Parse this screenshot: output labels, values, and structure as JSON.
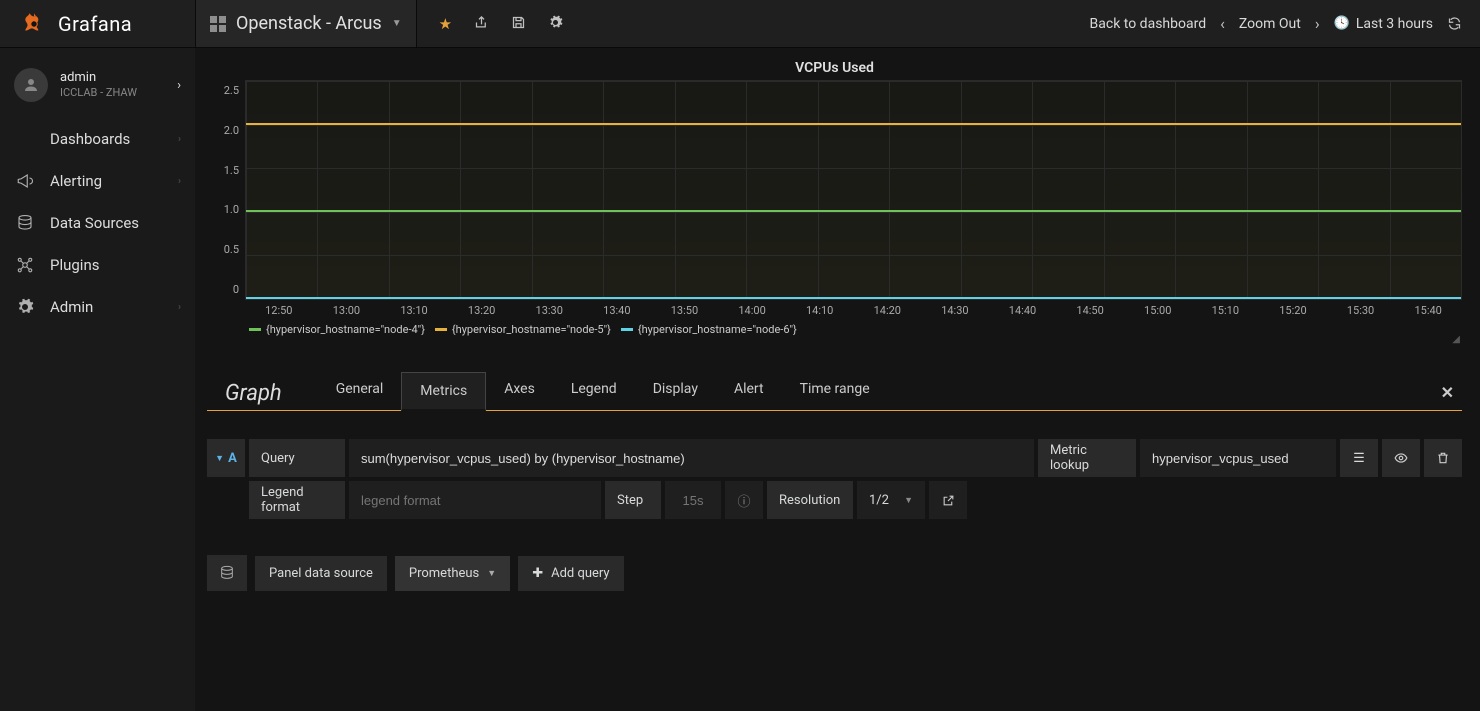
{
  "brand": {
    "name": "Grafana"
  },
  "header": {
    "dashboard_title": "Openstack - Arcus",
    "back_label": "Back to dashboard",
    "zoom_label": "Zoom Out",
    "time_range_label": "Last 3 hours"
  },
  "user": {
    "name": "admin",
    "org": "ICCLAB - ZHAW"
  },
  "sidebar": {
    "items": [
      {
        "label": "Dashboards"
      },
      {
        "label": "Alerting"
      },
      {
        "label": "Data Sources"
      },
      {
        "label": "Plugins"
      },
      {
        "label": "Admin"
      }
    ]
  },
  "panel": {
    "title": "VCPUs Used",
    "type_label": "Graph"
  },
  "chart_data": {
    "type": "line",
    "title": "VCPUs Used",
    "xlabel": "",
    "ylabel": "",
    "ylim": [
      0,
      2.5
    ],
    "y_ticks": [
      "2.5",
      "2.0",
      "1.5",
      "1.0",
      "0.5",
      "0"
    ],
    "x_ticks": [
      "12:50",
      "13:00",
      "13:10",
      "13:20",
      "13:30",
      "13:40",
      "13:50",
      "14:00",
      "14:10",
      "14:20",
      "14:30",
      "14:40",
      "14:50",
      "15:00",
      "15:10",
      "15:20",
      "15:30",
      "15:40"
    ],
    "series": [
      {
        "name": "{hypervisor_hostname=\"node-4\"}",
        "color": "#6fc25a",
        "value": 1.0
      },
      {
        "name": "{hypervisor_hostname=\"node-5\"}",
        "color": "#e6b23a",
        "value": 2.0
      },
      {
        "name": "{hypervisor_hostname=\"node-6\"}",
        "color": "#5fd2e6",
        "value": 0.0
      }
    ]
  },
  "editor": {
    "tabs": [
      "General",
      "Metrics",
      "Axes",
      "Legend",
      "Display",
      "Alert",
      "Time range"
    ],
    "active_tab": "Metrics",
    "query_letter": "A",
    "labels": {
      "query": "Query",
      "metric_lookup": "Metric lookup",
      "legend_format": "Legend format",
      "step": "Step",
      "resolution": "Resolution",
      "panel_ds": "Panel data source",
      "add_query": "Add query"
    },
    "query_expr": "sum(hypervisor_vcpus_used) by (hypervisor_hostname)",
    "metric_lookup_value": "hypervisor_vcpus_used",
    "legend_format_placeholder": "legend format",
    "step_placeholder": "15s",
    "resolution_value": "1/2",
    "datasource": "Prometheus"
  }
}
